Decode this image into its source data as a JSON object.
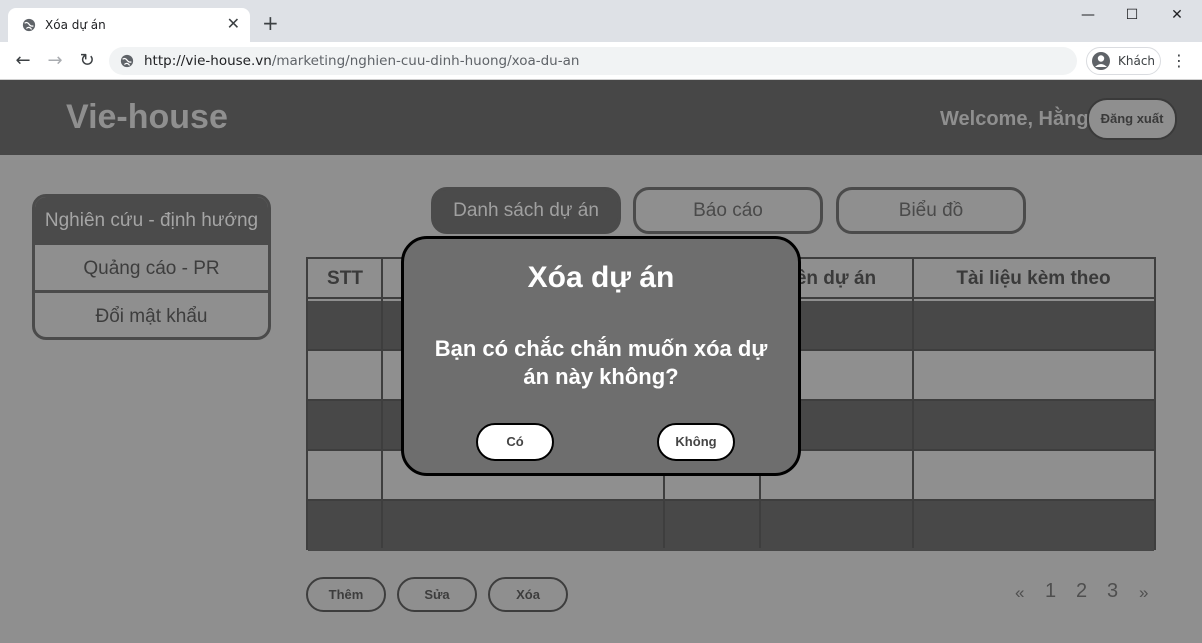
{
  "browser": {
    "tab_title": "Xóa dự án",
    "tab_close": "✕",
    "new_tab": "+",
    "window_controls": {
      "minimize": "—",
      "maximize": "☐",
      "close": "✕"
    },
    "url_host": "http://vie-house.vn",
    "url_path": "/marketing/nghien-cuu-dinh-huong/xoa-du-an",
    "profile_label": "Khách",
    "menu": "⋮"
  },
  "header": {
    "brand": "Vie-house",
    "welcome": "Welcome, Hằng",
    "logout_label": "Đăng xuất"
  },
  "sidebar": {
    "items": [
      {
        "label": "Nghiên cứu - định hướng",
        "active": true
      },
      {
        "label": "Quảng cáo - PR",
        "active": false
      },
      {
        "label": "Đổi mật khẩu",
        "active": false
      }
    ]
  },
  "tabs": [
    {
      "label": "Danh sách dự án",
      "active": true
    },
    {
      "label": "Báo cáo",
      "active": false
    },
    {
      "label": "Biểu đồ",
      "active": false
    }
  ],
  "table": {
    "columns": [
      "STT",
      "",
      "",
      "Tên dự án",
      "Tài liệu kèm theo"
    ],
    "visible_header": {
      "stt": "STT",
      "name_partial": "ên dự án",
      "docs": "Tài liệu kèm theo"
    },
    "rows": 5
  },
  "actions": {
    "add_label": "Thêm",
    "edit_label": "Sửa",
    "delete_label": "Xóa"
  },
  "pagination": {
    "prev": "«",
    "pages": [
      "1",
      "2",
      "3"
    ],
    "next": "»"
  },
  "modal": {
    "title": "Xóa dự án",
    "message": "Bạn có chắc chắn muốn xóa dự án này không?",
    "yes_label": "Có",
    "no_label": "Không"
  },
  "colors": {
    "header_bg": "#474747",
    "page_bg": "#8f8f8f",
    "dark_row": "#484848",
    "modal_bg": "#6e6e6e"
  }
}
